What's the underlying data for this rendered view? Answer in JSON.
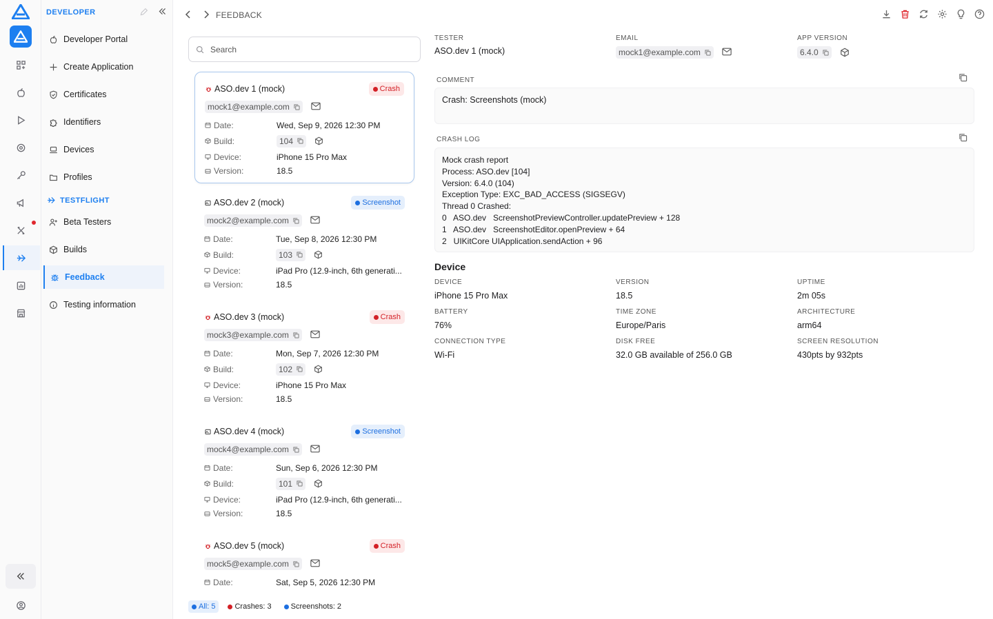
{
  "nav": {
    "section_developer": "DEVELOPER",
    "section_testflight": "TESTFLIGHT",
    "items": [
      {
        "label": "Developer Portal"
      },
      {
        "label": "Create Application"
      },
      {
        "label": "Certificates"
      },
      {
        "label": "Identifiers"
      },
      {
        "label": "Devices"
      },
      {
        "label": "Profiles"
      },
      {
        "label": "Beta Testers"
      },
      {
        "label": "Builds"
      },
      {
        "label": "Feedback"
      },
      {
        "label": "Testing information"
      }
    ]
  },
  "breadcrumb": "FEEDBACK",
  "search": {
    "placeholder": "Search",
    "value": ""
  },
  "feedback": [
    {
      "name": "ASO.dev 1 (mock)",
      "type": "Crash",
      "email": "mock1@example.com",
      "date_label": "Date:",
      "date": "Wed, Sep 9, 2026 12:30 PM",
      "build_label": "Build:",
      "build": "104",
      "device_label": "Device:",
      "device": "iPhone 15 Pro Max",
      "version_label": "Version:",
      "version": "18.5"
    },
    {
      "name": "ASO.dev 2 (mock)",
      "type": "Screenshot",
      "email": "mock2@example.com",
      "date_label": "Date:",
      "date": "Tue, Sep 8, 2026 12:30 PM",
      "build_label": "Build:",
      "build": "103",
      "device_label": "Device:",
      "device": "iPad Pro (12.9-inch, 6th generati...",
      "version_label": "Version:",
      "version": "18.5"
    },
    {
      "name": "ASO.dev 3 (mock)",
      "type": "Crash",
      "email": "mock3@example.com",
      "date_label": "Date:",
      "date": "Mon, Sep 7, 2026 12:30 PM",
      "build_label": "Build:",
      "build": "102",
      "device_label": "Device:",
      "device": "iPhone 15 Pro Max",
      "version_label": "Version:",
      "version": "18.5"
    },
    {
      "name": "ASO.dev 4 (mock)",
      "type": "Screenshot",
      "email": "mock4@example.com",
      "date_label": "Date:",
      "date": "Sun, Sep 6, 2026 12:30 PM",
      "build_label": "Build:",
      "build": "101",
      "device_label": "Device:",
      "device": "iPad Pro (12.9-inch, 6th generati...",
      "version_label": "Version:",
      "version": "18.5"
    },
    {
      "name": "ASO.dev 5 (mock)",
      "type": "Crash",
      "email": "mock5@example.com",
      "date_label": "Date:",
      "date": "Sat, Sep 5, 2026 12:30 PM"
    }
  ],
  "footer": {
    "all": "All: 5",
    "crashes": "Crashes: 3",
    "screenshots": "Screenshots: 2"
  },
  "detail": {
    "tester_label": "TESTER",
    "tester": "ASO.dev 1 (mock)",
    "email_label": "EMAIL",
    "email": "mock1@example.com",
    "app_version_label": "APP VERSION",
    "app_version": "6.4.0",
    "comment_label": "COMMENT",
    "comment": "Crash: Screenshots (mock)",
    "crash_log_label": "CRASH LOG",
    "crash_log": [
      "Mock crash report",
      "Process: ASO.dev [104]",
      "Version: 6.4.0 (104)",
      "Exception Type: EXC_BAD_ACCESS (SIGSEGV)",
      "Thread 0 Crashed:",
      "0   ASO.dev   ScreenshotPreviewController.updatePreview + 128",
      "1   ASO.dev   ScreenshotEditor.openPreview + 64",
      "2   UIKitCore UIApplication.sendAction + 96"
    ],
    "device_title": "Device",
    "device_fields": [
      {
        "label": "DEVICE",
        "value": "iPhone 15 Pro Max"
      },
      {
        "label": "VERSION",
        "value": "18.5"
      },
      {
        "label": "UPTIME",
        "value": "2m 05s"
      },
      {
        "label": "BATTERY",
        "value": "76%"
      },
      {
        "label": "TIME ZONE",
        "value": "Europe/Paris"
      },
      {
        "label": "ARCHITECTURE",
        "value": "arm64"
      },
      {
        "label": "CONNECTION TYPE",
        "value": "Wi-Fi"
      },
      {
        "label": "DISK FREE",
        "value": "32.0 GB available of 256.0 GB"
      },
      {
        "label": "SCREEN RESOLUTION",
        "value": "430pts by 932pts"
      }
    ]
  },
  "colors": {
    "accent": "#1d7ff0",
    "crash": "#d32026",
    "screenshot": "#1d6fe0"
  }
}
